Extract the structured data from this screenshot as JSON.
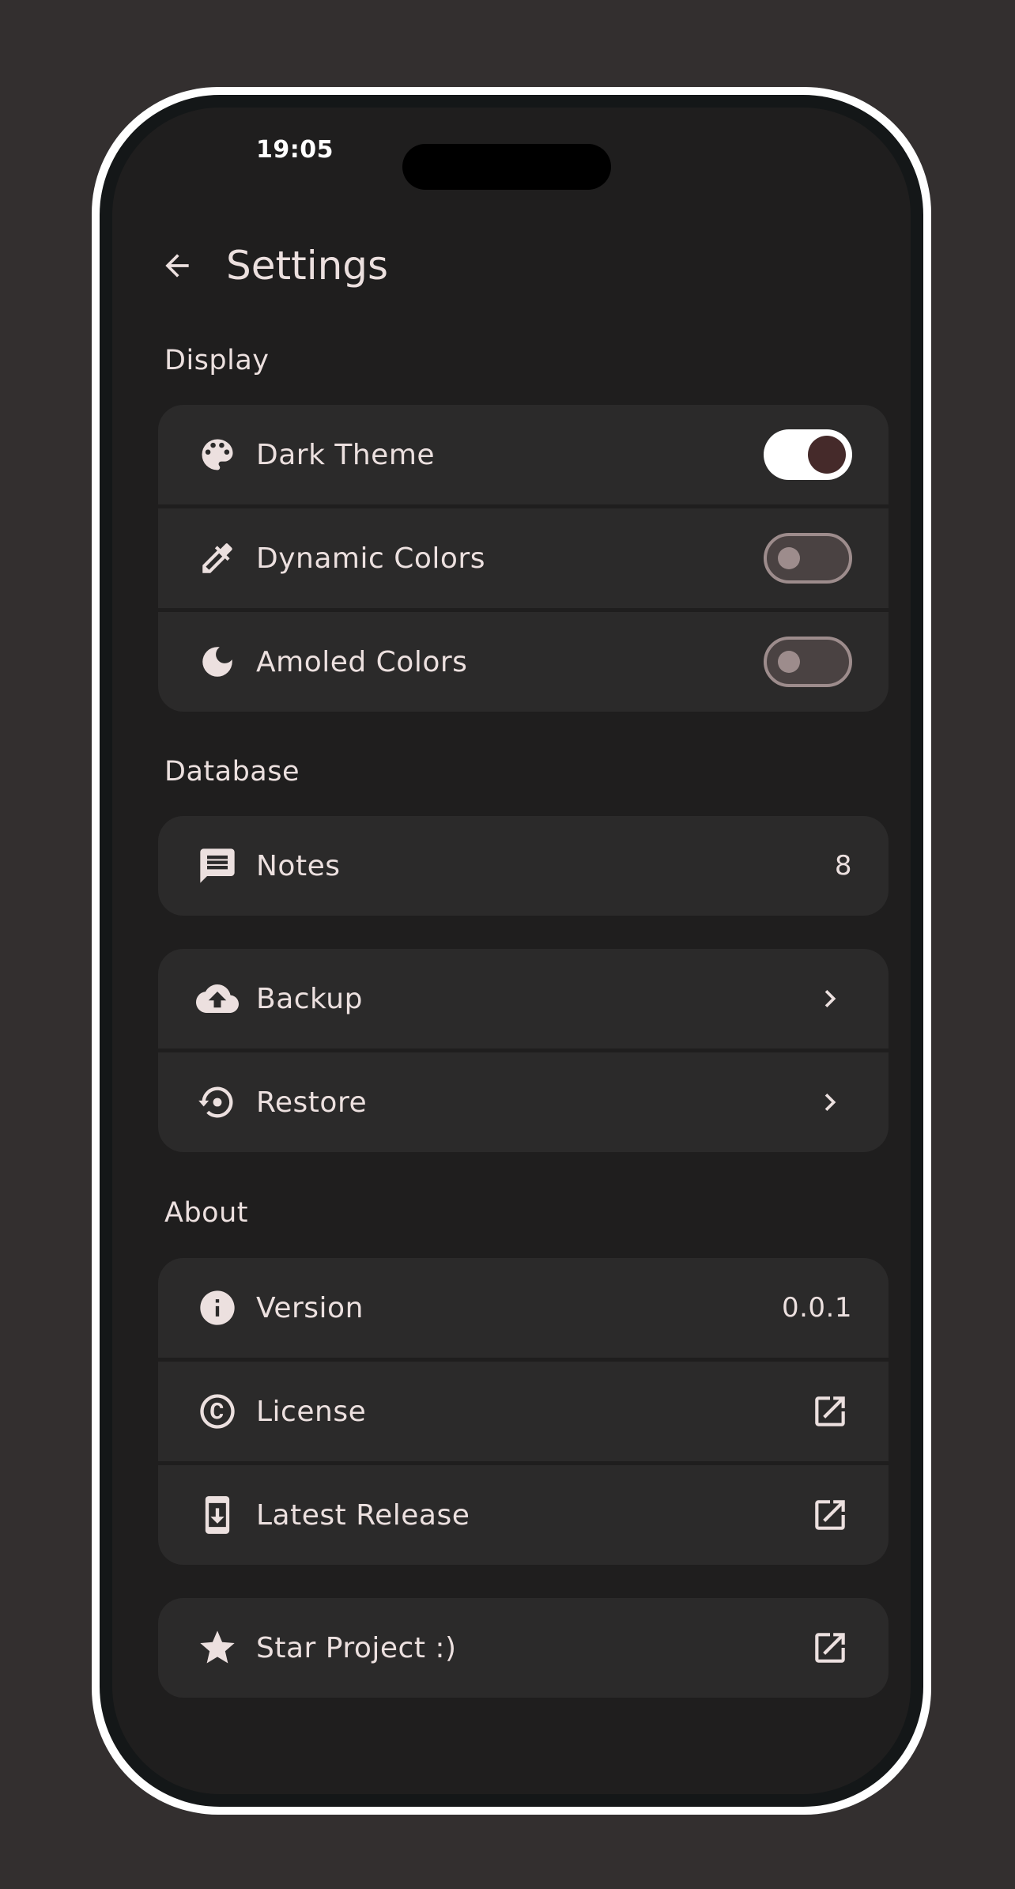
{
  "status_bar": {
    "time": "19:05"
  },
  "app_bar": {
    "title": "Settings",
    "back_icon": "arrow-left-icon"
  },
  "colors": {
    "background": "#332f2f",
    "screen": "#1f1e1e",
    "card": "#2b2a2a",
    "text": "#ece0df",
    "toggle_on_knob": "#452a2a"
  },
  "display": {
    "title": "Display",
    "items": [
      {
        "label": "Dark Theme",
        "icon": "palette-icon",
        "toggle": true
      },
      {
        "label": "Dynamic Colors",
        "icon": "eyedropper-icon",
        "toggle": false
      },
      {
        "label": "Amoled Colors",
        "icon": "moon-icon",
        "toggle": false
      }
    ]
  },
  "database": {
    "title": "Database",
    "notes": {
      "label": "Notes",
      "value": "8",
      "icon": "comment-icon"
    },
    "items": [
      {
        "label": "Backup",
        "icon": "cloud-upload-icon",
        "trailing": "chevron-right-icon"
      },
      {
        "label": "Restore",
        "icon": "restore-icon",
        "trailing": "chevron-right-icon"
      }
    ]
  },
  "about": {
    "title": "About",
    "items": [
      {
        "label": "Version",
        "value": "0.0.1",
        "icon": "info-icon"
      },
      {
        "label": "License",
        "icon": "copyright-icon",
        "trailing": "open-external-icon"
      },
      {
        "label": "Latest Release",
        "icon": "download-icon",
        "trailing": "open-external-icon"
      }
    ],
    "star": {
      "label": "Star Project :)",
      "icon": "star-icon",
      "trailing": "open-external-icon"
    }
  }
}
